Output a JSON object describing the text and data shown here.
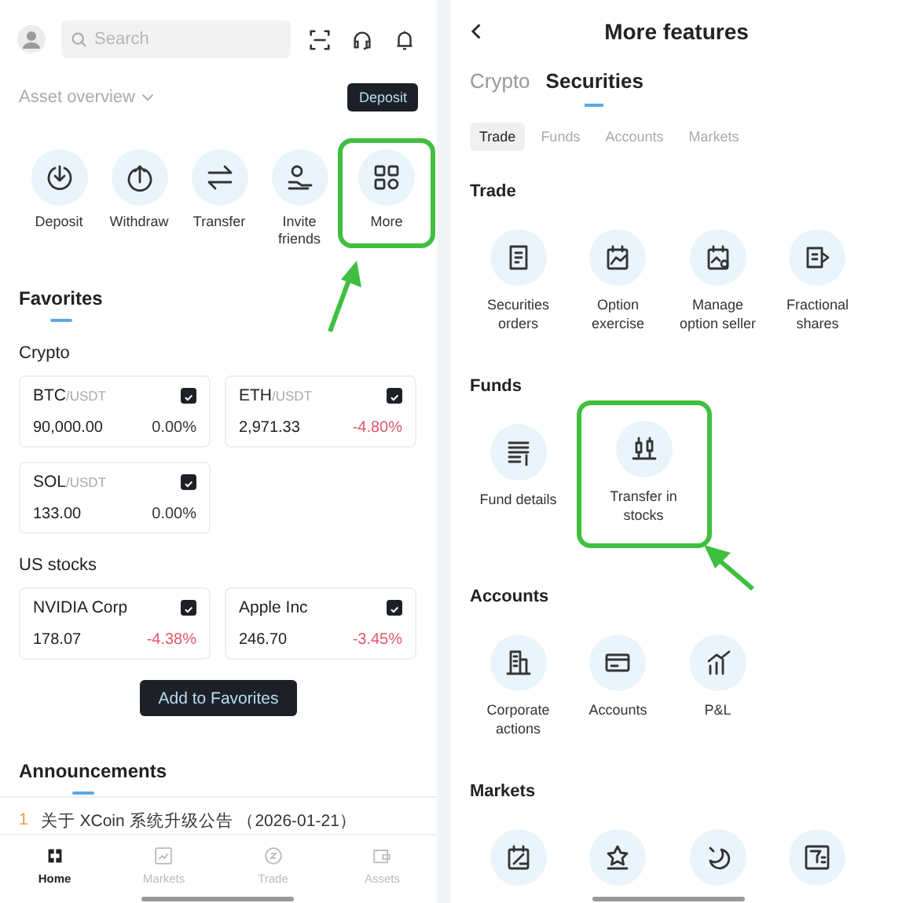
{
  "home": {
    "search": {
      "placeholder": "Search"
    },
    "asset_overview": "Asset overview",
    "deposit_button": "Deposit",
    "actions": [
      {
        "label": "Deposit",
        "highlighted": false
      },
      {
        "label": "Withdraw",
        "highlighted": false
      },
      {
        "label": "Transfer",
        "highlighted": false
      },
      {
        "label": "Invite friends",
        "highlighted": false
      },
      {
        "label": "More",
        "highlighted": true
      }
    ],
    "favorites_title": "Favorites",
    "groups": [
      {
        "title": "Crypto",
        "cards": [
          {
            "symbol": "BTC",
            "quote": "/USDT",
            "price": "90,000.00",
            "change": "0.00%",
            "color": "#333333",
            "checked": true
          },
          {
            "symbol": "ETH",
            "quote": "/USDT",
            "price": "2,971.33",
            "change": "-4.80%",
            "color": "#e0596a",
            "checked": true
          },
          {
            "symbol": "SOL",
            "quote": "/USDT",
            "price": "133.00",
            "change": "0.00%",
            "color": "#333333",
            "checked": true
          }
        ]
      },
      {
        "title": "US stocks",
        "cards": [
          {
            "symbol": "NVIDIA Corp",
            "price": "178.07",
            "change": "-4.38%",
            "color": "#e0596a",
            "checked": true
          },
          {
            "symbol": "Apple Inc",
            "price": "246.70",
            "change": "-3.45%",
            "color": "#e0596a",
            "checked": true
          }
        ]
      }
    ],
    "add_button": "Add to Favorites",
    "announcements_title": "Announcements",
    "announcements": [
      {
        "index": "1",
        "text": "关于 XCoin 系统升级公告 （2026-01-21）"
      }
    ],
    "nav": [
      {
        "label": "Home",
        "selected": true
      },
      {
        "label": "Markets",
        "selected": false
      },
      {
        "label": "Trade",
        "selected": false
      },
      {
        "label": "Assets",
        "selected": false
      }
    ]
  },
  "more_features": {
    "title": "More features",
    "tabs": [
      {
        "label": "Crypto",
        "selected": false
      },
      {
        "label": "Securities",
        "selected": true
      }
    ],
    "subtabs": [
      {
        "label": "Trade",
        "selected": true
      },
      {
        "label": "Funds",
        "selected": false
      },
      {
        "label": "Accounts",
        "selected": false
      },
      {
        "label": "Markets",
        "selected": false
      }
    ],
    "sections": [
      {
        "title": "Trade",
        "items": [
          {
            "label": "Securities orders",
            "highlighted": false
          },
          {
            "label": "Option exercise",
            "highlighted": false
          },
          {
            "label": "Manage option seller",
            "highlighted": false
          },
          {
            "label": "Fractional shares",
            "highlighted": false
          }
        ]
      },
      {
        "title": "Funds",
        "items": [
          {
            "label": "Fund details",
            "highlighted": false
          },
          {
            "label": "Transfer in stocks",
            "highlighted": true
          }
        ]
      },
      {
        "title": "Accounts",
        "items": [
          {
            "label": "Corporate actions",
            "highlighted": false
          },
          {
            "label": "Accounts",
            "highlighted": false
          },
          {
            "label": "P&L",
            "highlighted": false
          }
        ]
      },
      {
        "title": "Markets",
        "items": [
          {
            "highlighted": false
          },
          {
            "highlighted": false
          },
          {
            "highlighted": false
          },
          {
            "highlighted": false
          }
        ]
      }
    ]
  }
}
